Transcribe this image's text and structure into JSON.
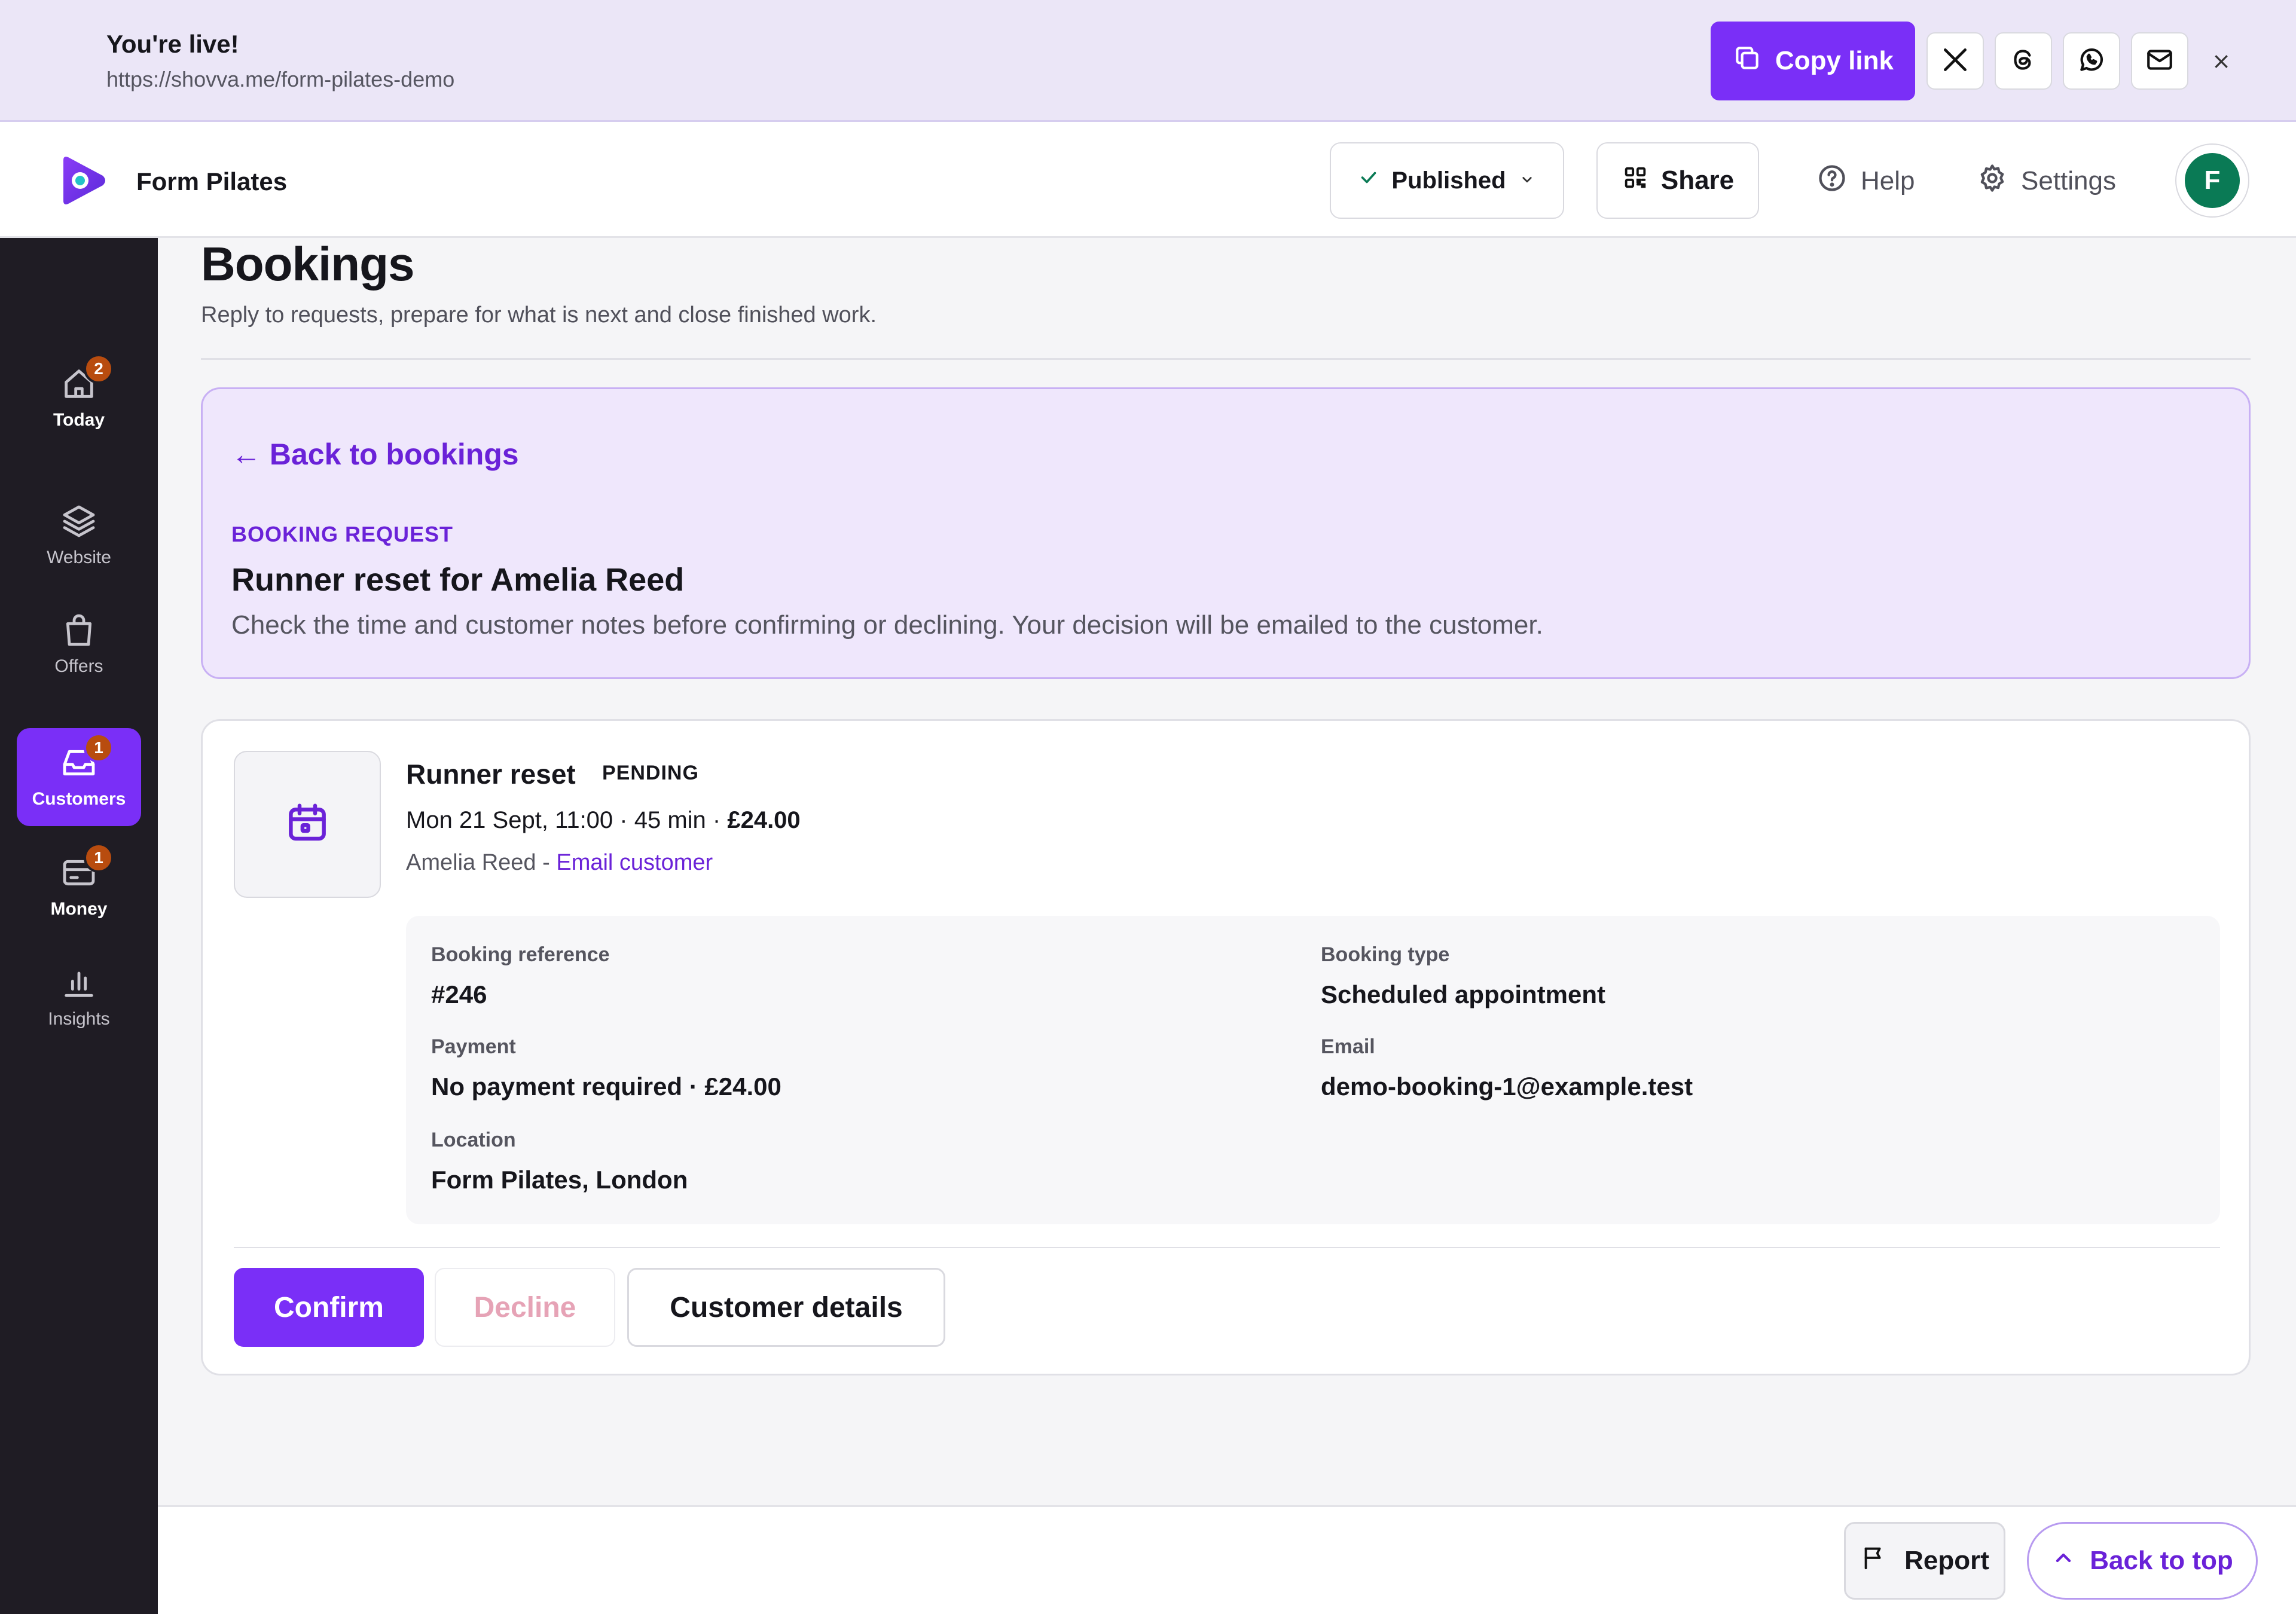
{
  "banner": {
    "title": "You're live!",
    "url": "https://shovva.me/form-pilates-demo",
    "copy_label": "Copy link",
    "share_icons": [
      "x-icon",
      "threads-icon",
      "whatsapp-icon",
      "mail-icon"
    ],
    "close_symbol": "×"
  },
  "header": {
    "app_name": "Form Pilates",
    "status_label": "Published",
    "share_label": "Share",
    "help_label": "Help",
    "settings_label": "Settings",
    "avatar_initial": "F"
  },
  "sidebar": {
    "items": [
      {
        "label": "Today",
        "icon": "home-icon",
        "badge": "2"
      },
      {
        "label": "Website",
        "icon": "layers-icon",
        "badge": null
      },
      {
        "label": "Offers",
        "icon": "bag-icon",
        "badge": null
      },
      {
        "label": "Customers",
        "icon": "inbox-icon",
        "badge": "1",
        "active": true
      },
      {
        "label": "Money",
        "icon": "card-icon",
        "badge": "1"
      },
      {
        "label": "Insights",
        "icon": "bar-chart-icon",
        "badge": null
      }
    ]
  },
  "page": {
    "title": "Bookings",
    "subtitle": "Reply to requests, prepare for what is next and close finished work."
  },
  "request": {
    "back_label": "← Back to bookings",
    "kicker": "BOOKING REQUEST",
    "title": "Runner reset for Amelia Reed",
    "description": "Check the time and customer notes before confirming or declining. Your decision will be emailed to the customer."
  },
  "booking": {
    "service": "Runner reset",
    "status": "PENDING",
    "meta_text": "Mon 21 Sept, 11:00 · 45 min · ",
    "price": "£24.00",
    "customer_name": "Amelia Reed",
    "separator": " - ",
    "email_link": "Email customer",
    "fields": {
      "reference_label": "Booking reference",
      "reference_value": "#246",
      "type_label": "Booking type",
      "type_value": "Scheduled appointment",
      "payment_label": "Payment",
      "payment_value": "No payment required · £24.00",
      "email_label": "Email",
      "email_value": "demo-booking-1@example.test",
      "location_label": "Location",
      "location_value": "Form Pilates, London"
    },
    "actions": {
      "confirm": "Confirm",
      "decline": "Decline",
      "details": "Customer details"
    }
  },
  "footer": {
    "report_label": "Report",
    "back_to_top_label": "Back to top"
  },
  "colors": {
    "accent": "#7a2ff7",
    "accent_text": "#6a22d8",
    "sidebar_bg": "#1f1c24",
    "banner_bg": "#ebe6f7",
    "badge": "#b84c0f",
    "avatar": "#0a7a55"
  }
}
